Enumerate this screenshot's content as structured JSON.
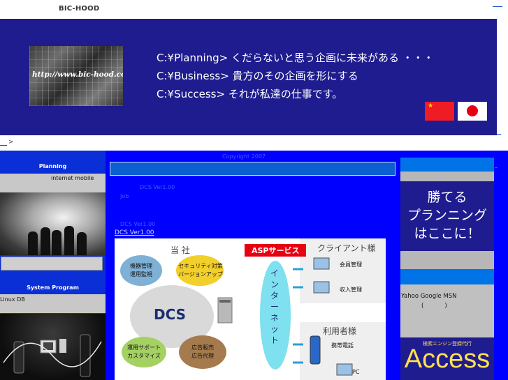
{
  "header": {
    "brand": "BIC-HOOD"
  },
  "banner": {
    "image_url_text": "http://www.bic-hood.com/",
    "lines": [
      "C:¥Planning> くだらないと思う企画に未来がある ・・・",
      "C:¥Business> 貴方のその企画を形にする",
      "C:¥Success> それが私達の仕事です。"
    ]
  },
  "breadcrumb": {
    "separator": ">"
  },
  "left": {
    "planning_title": "Planning",
    "planning_sub": "internet mobile",
    "system_title": "System Program",
    "system_sub": "Linux DB"
  },
  "center": {
    "copyright": "Copyright 2007",
    "dcs_line1": "DCS Ver1.00",
    "dcs_line1b": "Job",
    "dcs_line2": "DCS Ver1.00",
    "dcs_link": "DCS Ver1.00"
  },
  "diagram": {
    "company": "当 社",
    "asp": "ASPサービス",
    "client": "クライアント様",
    "user": "利用者様",
    "internet": "インターネット",
    "dcs": "DCS",
    "bubble_equipment": "機器管理\n運用監視",
    "bubble_security": "セキュリティ対策\nバージョンアップ",
    "bubble_support": "運用サポート\nカスタマイズ",
    "bubble_ads": "広告販売\n広告代理",
    "member_mgmt": "会員管理",
    "income_mgmt": "収入管理",
    "mobile": "携帯電話",
    "pc": "PC"
  },
  "right": {
    "ad_line1": "勝てる",
    "ad_line2": "プランニング",
    "ad_line3": "はここに！",
    "engines": "Yahoo Google MSN",
    "paren_open": "(",
    "paren_close": ")",
    "access_small": "検索エンジン登録代行",
    "access_big": "Access"
  },
  "colors": {
    "banner": "#1f1c8f",
    "main_blue": "#0000ff",
    "accent_blue": "#0073e6",
    "flag_red": "#e60012"
  }
}
